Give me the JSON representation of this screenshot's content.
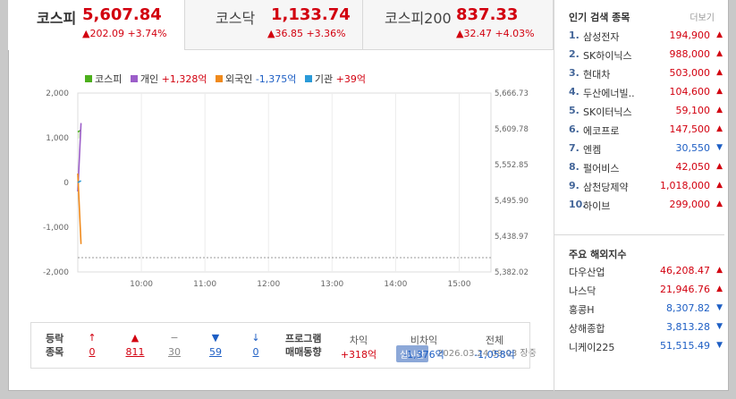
{
  "tabs": [
    {
      "name": "코스피",
      "value": "5,607.84",
      "change": "▲202.09 +3.74%",
      "active": true
    },
    {
      "name": "코스닥",
      "value": "1,133.74",
      "change": "▲36.85 +3.36%",
      "active": false
    },
    {
      "name": "코스피200",
      "value": "837.33",
      "change": "▲32.47 +4.03%",
      "active": false
    }
  ],
  "legend": [
    {
      "label": "코스피",
      "value": "",
      "color": "#4caf1c"
    },
    {
      "label": "개인",
      "value": "+1,328억",
      "color": "#9c5ec9"
    },
    {
      "label": "외국인",
      "value": "-1,375억",
      "color": "#f08a1c"
    },
    {
      "label": "기관",
      "value": "+39억",
      "color": "#2a9ad8"
    }
  ],
  "realtime_badge": "실시간",
  "timestamp": "2026.03.24 09:03  장중",
  "chart_data": {
    "type": "line",
    "x_ticks": [
      "10:00",
      "11:00",
      "12:00",
      "13:00",
      "14:00",
      "15:00"
    ],
    "y_left_ticks": [
      "2,000",
      "1,000",
      "0",
      "-1,000",
      "-2,000"
    ],
    "y_left_range": [
      -2000,
      2000
    ],
    "y_right_ticks": [
      "5,666.73",
      "5,609.78",
      "5,552.85",
      "5,495.90",
      "5,438.97",
      "5,382.02"
    ],
    "y_right_range": [
      5382.02,
      5666.73
    ],
    "series": [
      {
        "name": "코스피",
        "x": [
          "09:00",
          "09:03"
        ],
        "values": [
          5605.0,
          5607.84
        ],
        "axis": "right"
      },
      {
        "name": "개인",
        "x": [
          "09:00",
          "09:03"
        ],
        "values": [
          -200,
          1328
        ],
        "axis": "left"
      },
      {
        "name": "외국인",
        "x": [
          "09:00",
          "09:03"
        ],
        "values": [
          200,
          -1375
        ],
        "axis": "left"
      },
      {
        "name": "기관",
        "x": [
          "09:00",
          "09:03"
        ],
        "values": [
          0,
          39
        ],
        "axis": "left"
      }
    ]
  },
  "stats": {
    "label1": "등락",
    "label2": "종목",
    "cells": [
      {
        "sym": "↑",
        "num": "0",
        "color": "red"
      },
      {
        "sym": "▲",
        "num": "811",
        "color": "red"
      },
      {
        "sym": "−",
        "num": "30",
        "color": "gray"
      },
      {
        "sym": "▼",
        "num": "59",
        "color": "blue"
      },
      {
        "sym": "↓",
        "num": "0",
        "color": "blue"
      }
    ],
    "program_label1": "프로그램",
    "program_label2": "매매동향",
    "program": [
      {
        "head": "차익",
        "value": "+318억",
        "color": "red"
      },
      {
        "head": "비차익",
        "value": "-1,376억",
        "color": "blue"
      },
      {
        "head": "전체",
        "value": "-1,058억",
        "color": "blue"
      }
    ]
  },
  "popular": {
    "title": "인기 검색 종목",
    "more": "더보기",
    "items": [
      {
        "rank": "1.",
        "name": "삼성전자",
        "price": "194,900",
        "dir": "up"
      },
      {
        "rank": "2.",
        "name": "SK하이닉스",
        "price": "988,000",
        "dir": "up"
      },
      {
        "rank": "3.",
        "name": "현대차",
        "price": "503,000",
        "dir": "up"
      },
      {
        "rank": "4.",
        "name": "두산에너빌..",
        "price": "104,600",
        "dir": "up"
      },
      {
        "rank": "5.",
        "name": "SK이터닉스",
        "price": "59,100",
        "dir": "up"
      },
      {
        "rank": "6.",
        "name": "에코프로",
        "price": "147,500",
        "dir": "up"
      },
      {
        "rank": "7.",
        "name": "엔켐",
        "price": "30,550",
        "dir": "down"
      },
      {
        "rank": "8.",
        "name": "펄어비스",
        "price": "42,050",
        "dir": "up"
      },
      {
        "rank": "9.",
        "name": "삼천당제약",
        "price": "1,018,000",
        "dir": "up"
      },
      {
        "rank": "10.",
        "name": "하이브",
        "price": "299,000",
        "dir": "up"
      }
    ]
  },
  "overseas": {
    "title": "주요 해외지수",
    "items": [
      {
        "name": "다우산업",
        "value": "46,208.47",
        "dir": "up"
      },
      {
        "name": "나스닥",
        "value": "21,946.76",
        "dir": "up"
      },
      {
        "name": "홍콩H",
        "value": "8,307.82",
        "dir": "down"
      },
      {
        "name": "상해종합",
        "value": "3,813.28",
        "dir": "down"
      },
      {
        "name": "니케이225",
        "value": "51,515.49",
        "dir": "down"
      }
    ]
  },
  "colors": {
    "up": "#d2000f",
    "down": "#1d5ec4"
  }
}
